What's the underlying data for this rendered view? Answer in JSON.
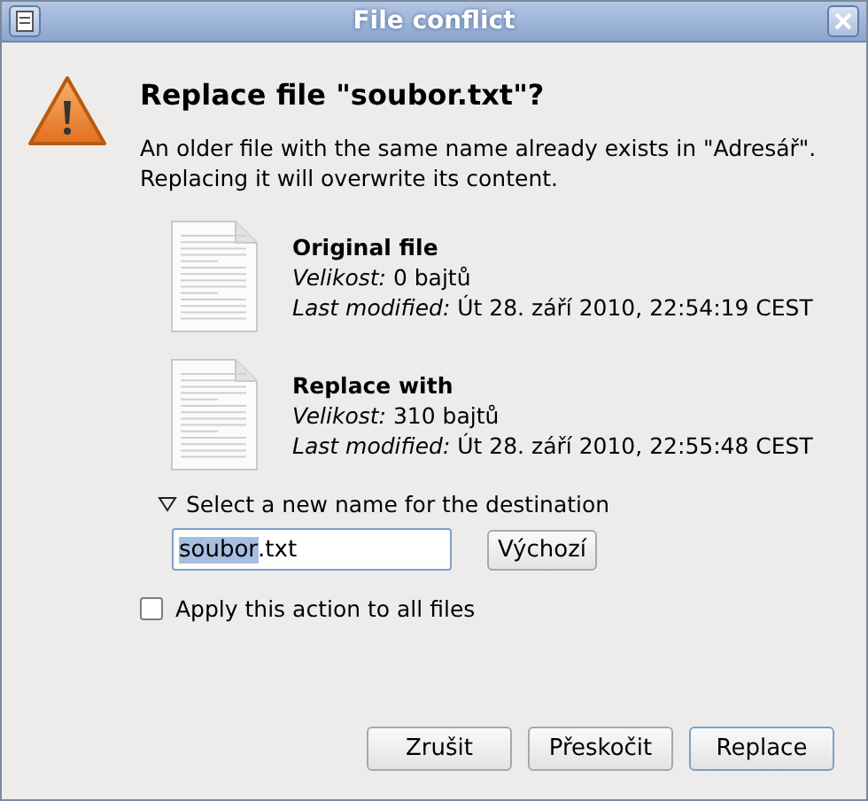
{
  "window": {
    "title": "File conflict"
  },
  "heading": "Replace file \"soubor.txt\"?",
  "message": [
    "An older file with the same name already exists in \"Adresář\".",
    "Replacing it will overwrite its content."
  ],
  "files": [
    {
      "title": "Original file",
      "size": "*Velikost:* 0 bajtů",
      "modified": "*Last modified:* Út 28. září 2010, 22:54:19 CEST"
    },
    {
      "title": "Replace with",
      "size": "*Velikost:* 310 bajtů",
      "modified": "*Last modified:* Út 28. září 2010, 22:55:48 CEST"
    }
  ],
  "rename": {
    "label": "Select a new name for the destination",
    "expanded": true,
    "selected_text": "soubor",
    "rest_text": ".txt",
    "reset_button": "Výchozí"
  },
  "apply_all": {
    "label": "Apply this action to all files",
    "checked": false
  },
  "buttons": [
    {
      "label": "Zrušit",
      "default": false
    },
    {
      "label": "Přeskočit",
      "default": false
    },
    {
      "label": "Replace",
      "default": true
    }
  ]
}
